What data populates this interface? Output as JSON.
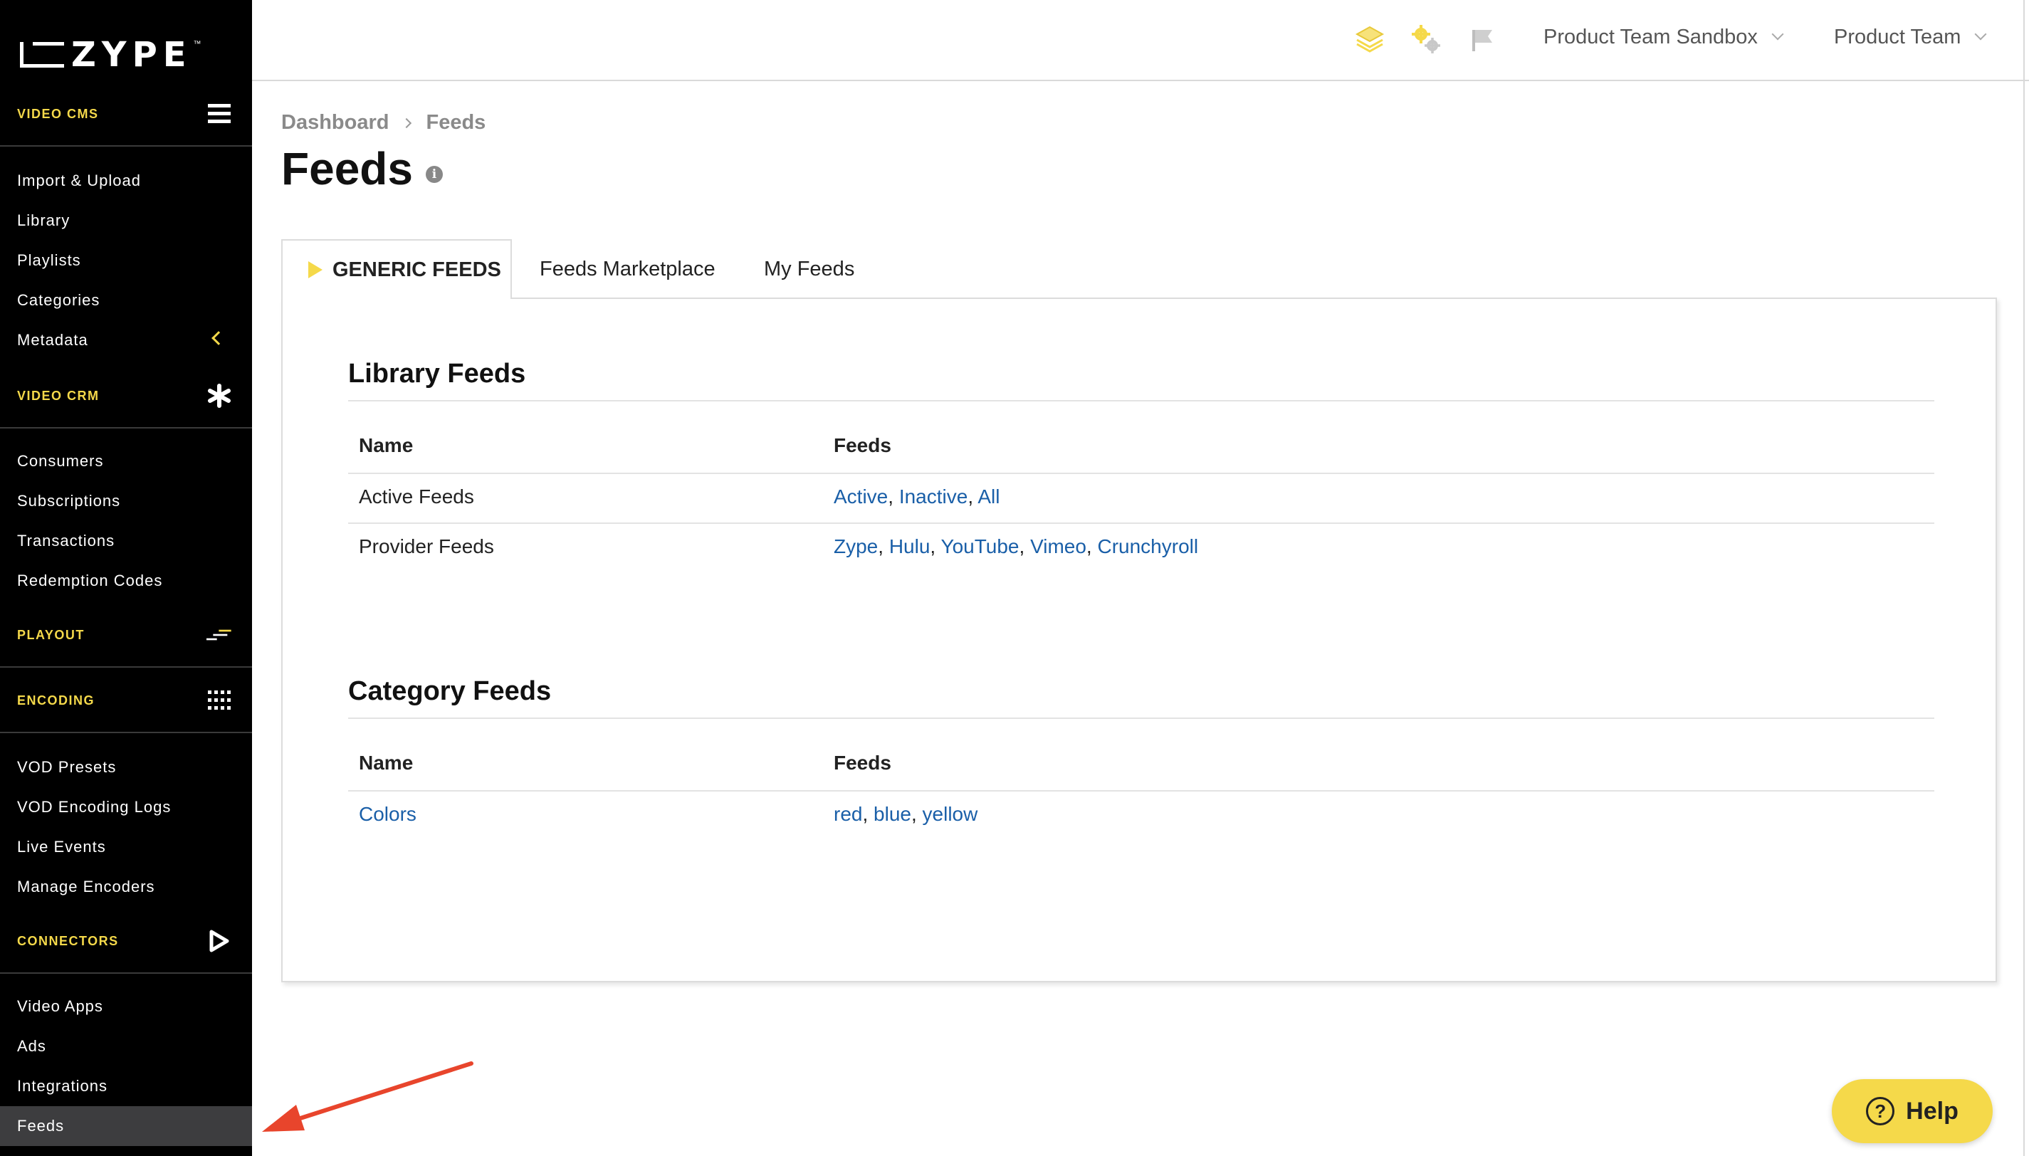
{
  "brand": {
    "name": "ZYPE",
    "tm": "™"
  },
  "sidebar": {
    "sections": {
      "video_cms": {
        "label": "VIDEO CMS",
        "icon": "hamburger-icon"
      },
      "video_crm": {
        "label": "VIDEO CRM",
        "icon": "asterisk-icon"
      },
      "playout": {
        "label": "PLAYOUT",
        "icon": "playout-lines-icon"
      },
      "encoding": {
        "label": "ENCODING",
        "icon": "grid-dots-icon"
      },
      "connectors": {
        "label": "CONNECTORS",
        "icon": "play-outline-icon"
      }
    },
    "cms_items": [
      "Import & Upload",
      "Library",
      "Playlists",
      "Categories",
      "Metadata"
    ],
    "crm_items": [
      "Consumers",
      "Subscriptions",
      "Transactions",
      "Redemption Codes"
    ],
    "encoding_items": [
      "VOD Presets",
      "VOD Encoding Logs",
      "Live Events",
      "Manage Encoders"
    ],
    "connectors_items": [
      "Video Apps",
      "Ads",
      "Integrations",
      "Feeds"
    ],
    "active_item": "Feeds"
  },
  "topbar": {
    "icons": [
      "stack-icon",
      "gears-icon",
      "flag-icon"
    ],
    "org_dropdown": "Product Team Sandbox",
    "team_dropdown": "Product Team"
  },
  "breadcrumb": {
    "root": "Dashboard",
    "current": "Feeds"
  },
  "page": {
    "title": "Feeds"
  },
  "tabs": [
    {
      "label": "GENERIC FEEDS",
      "active": true
    },
    {
      "label": "Feeds Marketplace",
      "active": false
    },
    {
      "label": "My Feeds",
      "active": false
    }
  ],
  "library_feeds": {
    "title": "Library Feeds",
    "columns": [
      "Name",
      "Feeds"
    ],
    "rows": [
      {
        "name": "Active Feeds",
        "feeds": [
          "Active",
          "Inactive",
          "All"
        ]
      },
      {
        "name": "Provider Feeds",
        "feeds": [
          "Zype",
          "Hulu",
          "YouTube",
          "Vimeo",
          "Crunchyroll"
        ]
      }
    ]
  },
  "category_feeds": {
    "title": "Category Feeds",
    "columns": [
      "Name",
      "Feeds"
    ],
    "rows": [
      {
        "name": "Colors",
        "feeds": [
          "red",
          "blue",
          "yellow"
        ]
      }
    ]
  },
  "help": {
    "label": "Help"
  },
  "colors": {
    "accent_yellow": "#f5d94a",
    "link_blue": "#1a5fa8",
    "sidebar_bg": "#000000",
    "active_item_bg": "#3d3d3f",
    "annotation_arrow": "#e8452c"
  }
}
